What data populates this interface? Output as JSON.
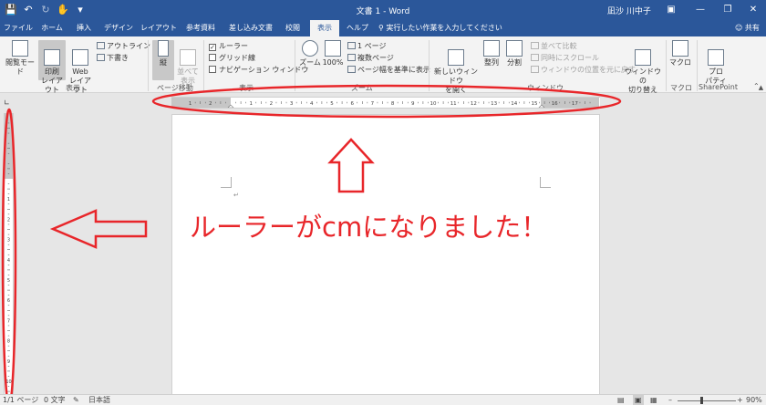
{
  "titlebar": {
    "save_icon": "save-icon",
    "undo_icon": "undo-icon",
    "redo_icon": "redo-icon",
    "touch_icon": "touch-mode-icon",
    "title": "文書 1  -  Word",
    "user": "凪沙 川中子"
  },
  "tabs": [
    "ファイル",
    "ホーム",
    "挿入",
    "デザイン",
    "レイアウト",
    "参考資料",
    "差し込み文書",
    "校閲",
    "表示",
    "ヘルプ"
  ],
  "active_tab": "表示",
  "tell_me": "実行したい作業を入力してください",
  "share": "共有",
  "ribbon": {
    "views": {
      "label": "表示",
      "read_mode": "閲覧モード",
      "print_layout": "印刷\nレイアウト",
      "web_layout": "Web\nレイアウト",
      "outline": "アウトライン",
      "draft": "下書き"
    },
    "page_move": {
      "label": "ページ移動",
      "vertical": "縦",
      "side_by_side": "並べて\n表示"
    },
    "show": {
      "label": "表示",
      "ruler": "ルーラー",
      "gridlines": "グリッド線",
      "nav_pane": "ナビゲーション ウィンドウ"
    },
    "zoom": {
      "label": "ズーム",
      "zoom": "ズーム",
      "hundred": "100%",
      "one_page": "1 ページ",
      "multi_page": "複数ページ",
      "page_width": "ページ幅を基準に表示"
    },
    "window": {
      "label": "ウィンドウ",
      "new_window": "新しいウィンドウ\nを開く",
      "arrange": "整列",
      "split": "分割",
      "side_by_side": "並べて比較",
      "sync_scroll": "同時にスクロール",
      "reset_pos": "ウィンドウの位置を元に戻す",
      "switch": "ウィンドウの\n切り替え"
    },
    "macro": {
      "label": "マクロ",
      "macro": "マクロ"
    },
    "sharepoint": {
      "label": "SharePoint",
      "properties": "プロ\nパティ"
    }
  },
  "annotation": "ルーラーがcmになりました！",
  "status": {
    "page": "1/1 ページ",
    "words": "0 文字",
    "language": "日本語",
    "zoom": "90%"
  },
  "ruler_numbers_h": [
    "1",
    "2",
    "1",
    "2",
    "3",
    "4",
    "5",
    "6",
    "7",
    "8",
    "9",
    "10",
    "11",
    "12",
    "13",
    "14",
    "15",
    "16",
    "17"
  ],
  "ruler_numbers_v": [
    "1",
    "2",
    "3",
    "4",
    "5",
    "6",
    "7",
    "8",
    "9",
    "10",
    "11"
  ],
  "colors": {
    "accent": "#2b579a",
    "annotation_red": "#e8262a"
  }
}
